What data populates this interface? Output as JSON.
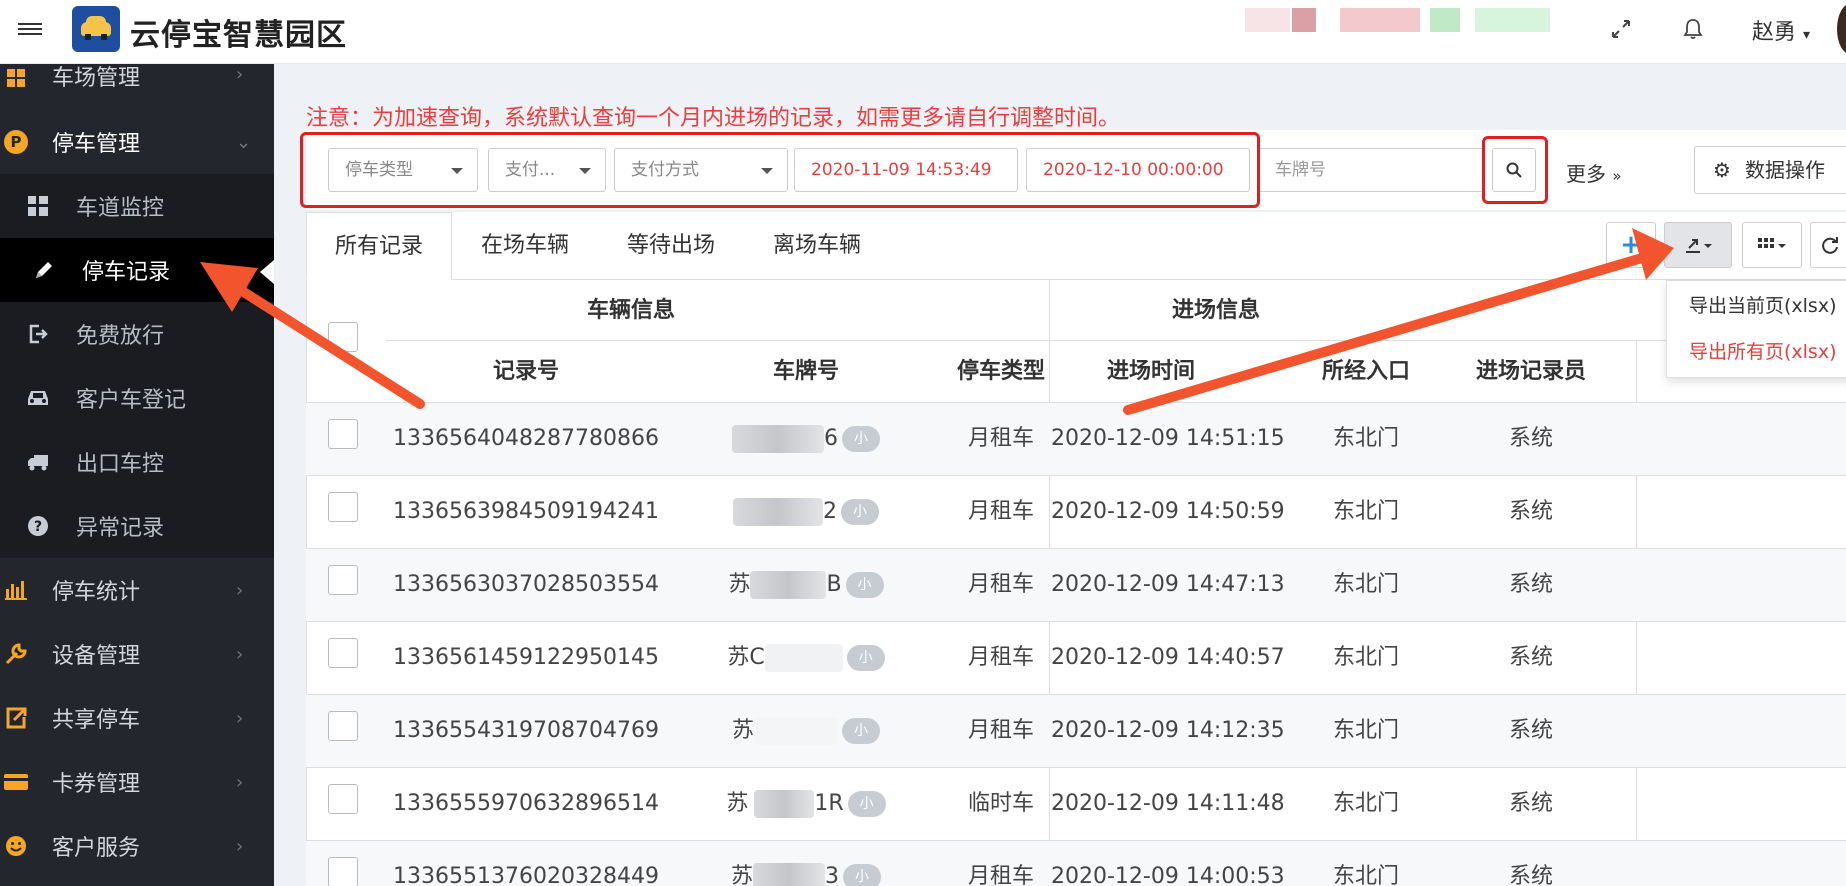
{
  "header": {
    "brand": "云停宝智慧园区",
    "user_name": "赵勇"
  },
  "sidebar": {
    "items": [
      {
        "label": "车场管理",
        "icon": "windows-grid-icon"
      },
      {
        "label": "停车管理",
        "icon": "parking-icon"
      },
      {
        "label": "停车统计",
        "icon": "bar-chart-icon"
      },
      {
        "label": "设备管理",
        "icon": "wrench-icon"
      },
      {
        "label": "共享停车",
        "icon": "share-icon"
      },
      {
        "label": "卡券管理",
        "icon": "card-icon"
      },
      {
        "label": "客户服务",
        "icon": "smile-icon"
      }
    ],
    "sub_items": [
      {
        "label": "车道监控",
        "icon": "dashboard-icon"
      },
      {
        "label": "停车记录",
        "icon": "pencil-icon"
      },
      {
        "label": "免费放行",
        "icon": "exit-icon"
      },
      {
        "label": "客户车登记",
        "icon": "car-icon"
      },
      {
        "label": "出口车控",
        "icon": "truck-icon"
      },
      {
        "label": "异常记录",
        "icon": "question-icon"
      }
    ]
  },
  "notice": "注意：为加速查询，系统默认查询一个月内进场的记录，如需更多请自行调整时间。",
  "filters": {
    "parking_type": "停车类型",
    "pay_status": "支付...",
    "pay_method": "支付方式",
    "start_time": "2020-11-09 14:53:49",
    "end_time": "2020-12-10 00:00:00",
    "plate_placeholder": "车牌号",
    "more": "更多",
    "data_ops": "数据操作"
  },
  "tabs": [
    "所有记录",
    "在场车辆",
    "等待出场",
    "离场车辆"
  ],
  "export_menu": [
    "导出当前页(xlsx)",
    "导出所有页(xlsx)"
  ],
  "table": {
    "groups": [
      "车辆信息",
      "进场信息"
    ],
    "columns": [
      "记录号",
      "车牌号",
      "停车类型",
      "进场时间",
      "所经入口",
      "进场记录员"
    ],
    "rows": [
      {
        "id": "1336564048287780866",
        "plate_a": "",
        "plate_b": "6",
        "badge": "小",
        "type": "月租车",
        "time": "2020-12-09 14:51:15",
        "gate": "东北门",
        "clerk": "系统"
      },
      {
        "id": "1336563984509194241",
        "plate_a": "",
        "plate_b": "2",
        "badge": "小",
        "type": "月租车",
        "time": "2020-12-09 14:50:59",
        "gate": "东北门",
        "clerk": "系统"
      },
      {
        "id": "1336563037028503554",
        "plate_a": "苏",
        "plate_b": "B",
        "badge": "小",
        "type": "月租车",
        "time": "2020-12-09 14:47:13",
        "gate": "东北门",
        "clerk": "系统"
      },
      {
        "id": "1336561459122950145",
        "plate_a": "苏C",
        "plate_b": "",
        "badge": "小",
        "type": "月租车",
        "time": "2020-12-09 14:40:57",
        "gate": "东北门",
        "clerk": "系统"
      },
      {
        "id": "1336554319708704769",
        "plate_a": "苏",
        "plate_b": "",
        "badge": "小",
        "type": "月租车",
        "time": "2020-12-09 14:12:35",
        "gate": "东北门",
        "clerk": "系统"
      },
      {
        "id": "1336555970632896514",
        "plate_a": "苏",
        "plate_b": "1R",
        "badge": "小",
        "type": "临时车",
        "time": "2020-12-09 14:11:48",
        "gate": "东北门",
        "clerk": "系统"
      },
      {
        "id": "1336551376020328449",
        "plate_a": "苏",
        "plate_b": "3",
        "badge": "小",
        "type": "月租车",
        "time": "2020-12-09 14:00:53",
        "gate": "东北门",
        "clerk": "系统"
      }
    ]
  },
  "colors": {
    "annotation": "#e02020",
    "accent": "#f5a623",
    "notice": "#e83e3e"
  }
}
